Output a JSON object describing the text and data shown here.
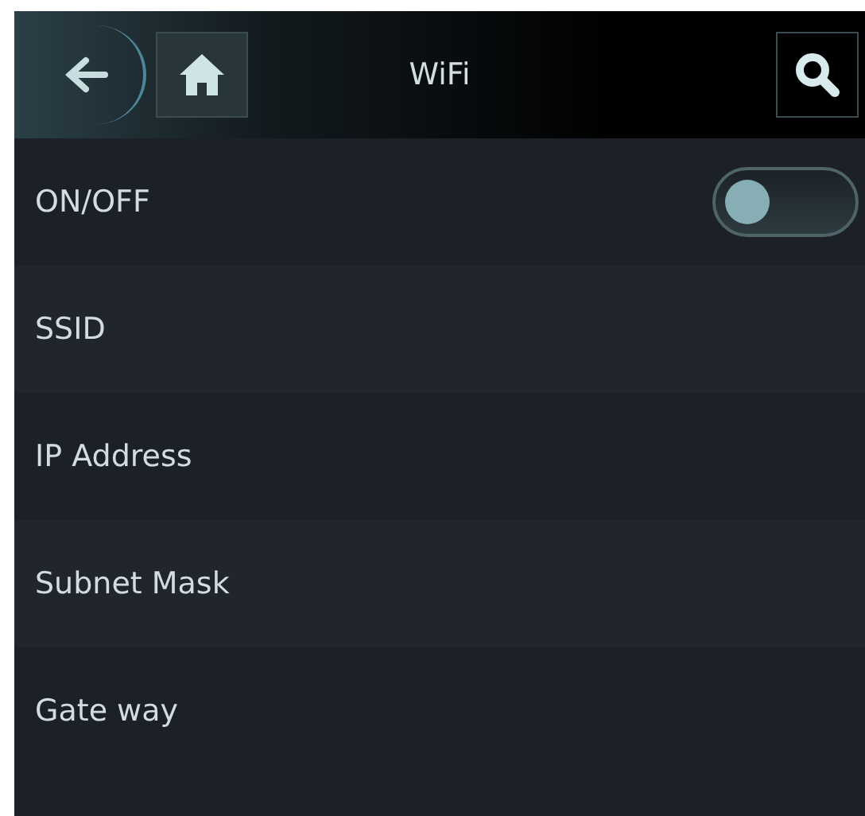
{
  "header": {
    "title": "WiFi"
  },
  "rows": [
    {
      "label": "ON/OFF",
      "kind": "toggle",
      "on": false
    },
    {
      "label": "SSID",
      "kind": "text"
    },
    {
      "label": "IP Address",
      "kind": "text"
    },
    {
      "label": "Subnet Mask",
      "kind": "text"
    },
    {
      "label": "Gate way",
      "kind": "text"
    }
  ]
}
